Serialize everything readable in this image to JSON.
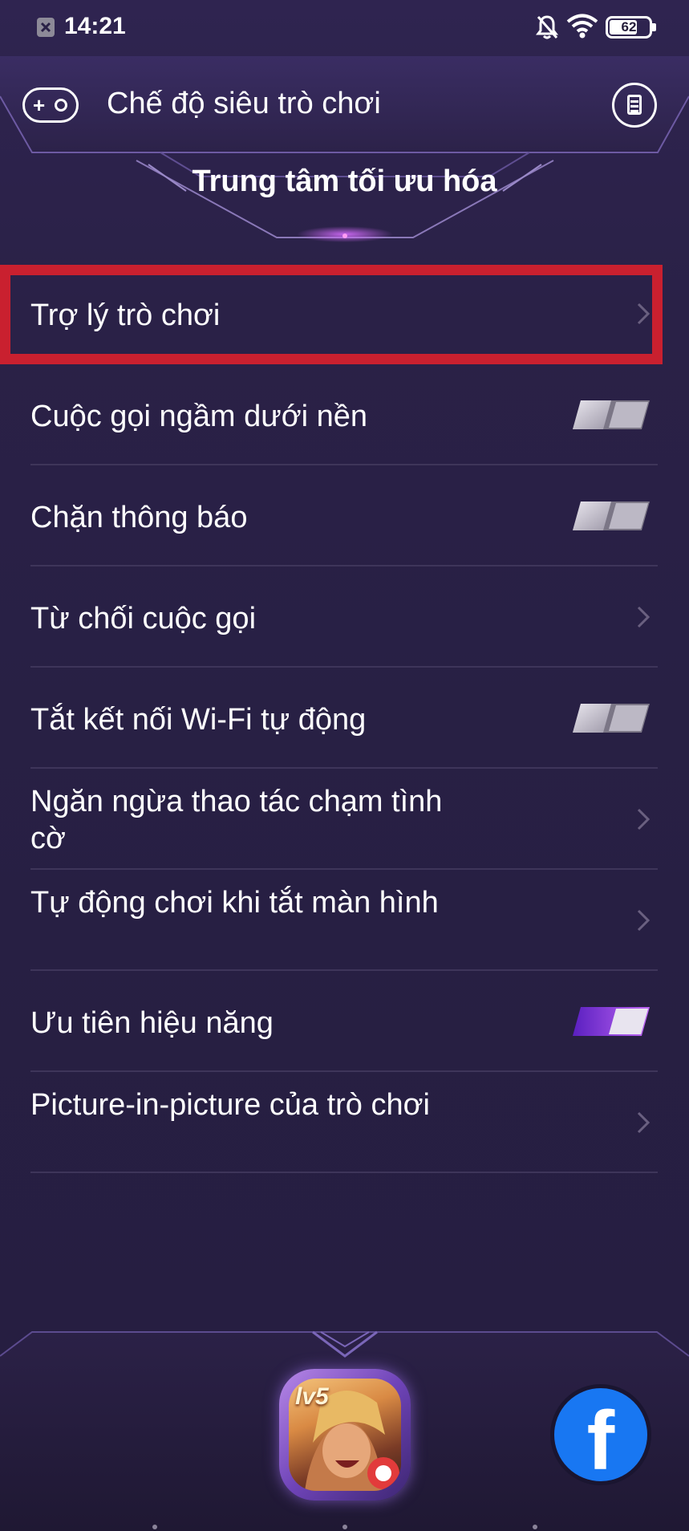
{
  "status_bar": {
    "time": "14:21",
    "battery": "62",
    "icons": [
      "notification-icon",
      "bell-off-icon",
      "wifi-icon",
      "battery-icon"
    ]
  },
  "header": {
    "title": "Chế độ siêu trò chơi",
    "section_title": "Trung tâm tối ưu hóa"
  },
  "settings": [
    {
      "label": "Trợ lý trò chơi",
      "control": "chevron"
    },
    {
      "label": "Cuộc gọi ngầm dưới nền",
      "control": "toggle",
      "on": false
    },
    {
      "label": "Chặn thông báo",
      "control": "toggle",
      "on": false
    },
    {
      "label": "Từ chối cuộc gọi",
      "control": "chevron"
    },
    {
      "label": "Tắt kết nối Wi-Fi tự động",
      "control": "toggle",
      "on": false
    },
    {
      "label": "Ngăn ngừa thao tác chạm tình cờ",
      "control": "chevron"
    },
    {
      "label": "Tự động chơi khi tắt màn hình",
      "control": "chevron"
    },
    {
      "label": "Ưu tiên hiệu năng",
      "control": "toggle",
      "on": true
    },
    {
      "label": "Picture-in-picture của trò chơi",
      "control": "chevron"
    }
  ],
  "dock": {
    "game_badge": "lv5",
    "fb_glyph": "f"
  },
  "colors": {
    "background": "#28203f",
    "highlight": "#c9202f",
    "accent": "#8e4bd6",
    "separator": "#3e355a"
  }
}
